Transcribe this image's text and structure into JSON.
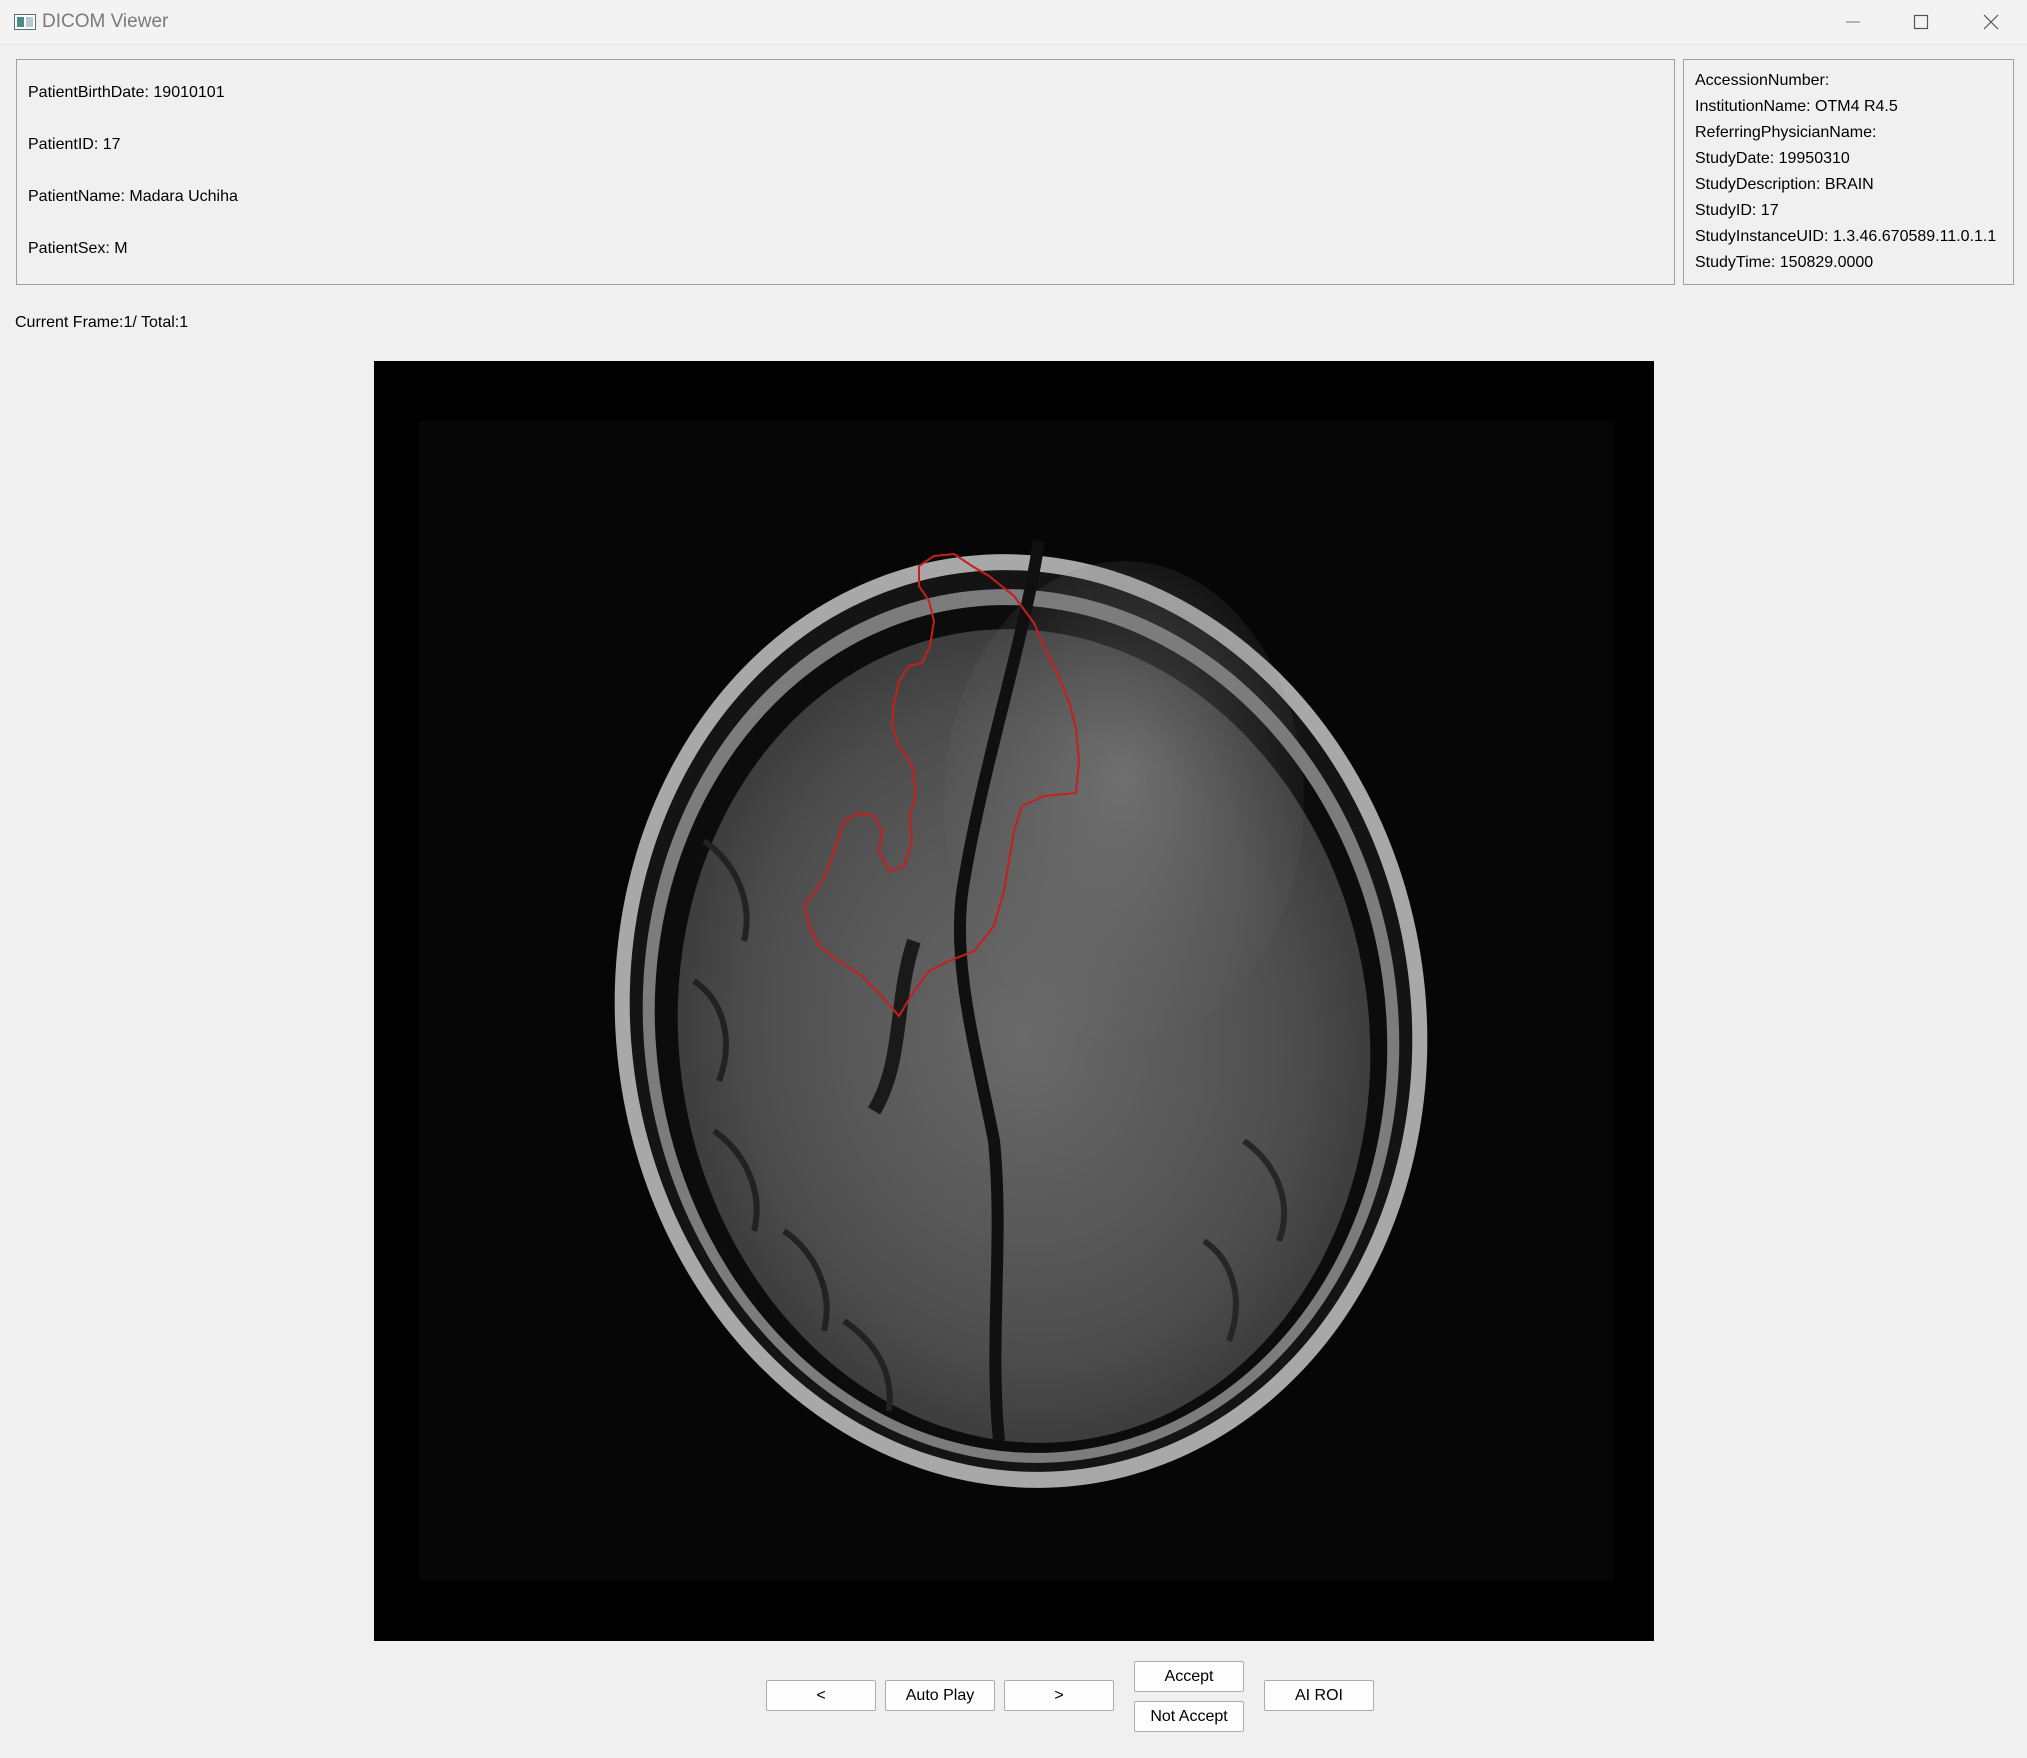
{
  "window": {
    "title": "DICOM Viewer",
    "controls": [
      "minimize-icon",
      "maximize-icon",
      "close-icon"
    ]
  },
  "patient": {
    "birth_date": "PatientBirthDate: 19010101",
    "id": "PatientID: 17",
    "name": "PatientName: Madara Uchiha",
    "sex": "PatientSex: M"
  },
  "study": {
    "accession_number": "AccessionNumber:",
    "institution_name": "InstitutionName: OTM4 R4.5",
    "referring_physician": "ReferringPhysicianName:",
    "study_date": "StudyDate: 19950310",
    "study_description": "StudyDescription: BRAIN",
    "study_id": "StudyID: 17",
    "study_instance_uid": "StudyInstanceUID: 1.3.46.670589.11.0.1.1",
    "study_time": "StudyTime: 150829.0000"
  },
  "frame": {
    "label": "Current Frame:1/ Total:1"
  },
  "image": {
    "roi_color": "#c81e1e"
  },
  "controls": {
    "prev_label": "<",
    "autoplay_label": "Auto Play",
    "next_label": ">",
    "accept_label": "Accept",
    "not_accept_label": "Not Accept",
    "ai_roi_label": "AI ROI"
  }
}
